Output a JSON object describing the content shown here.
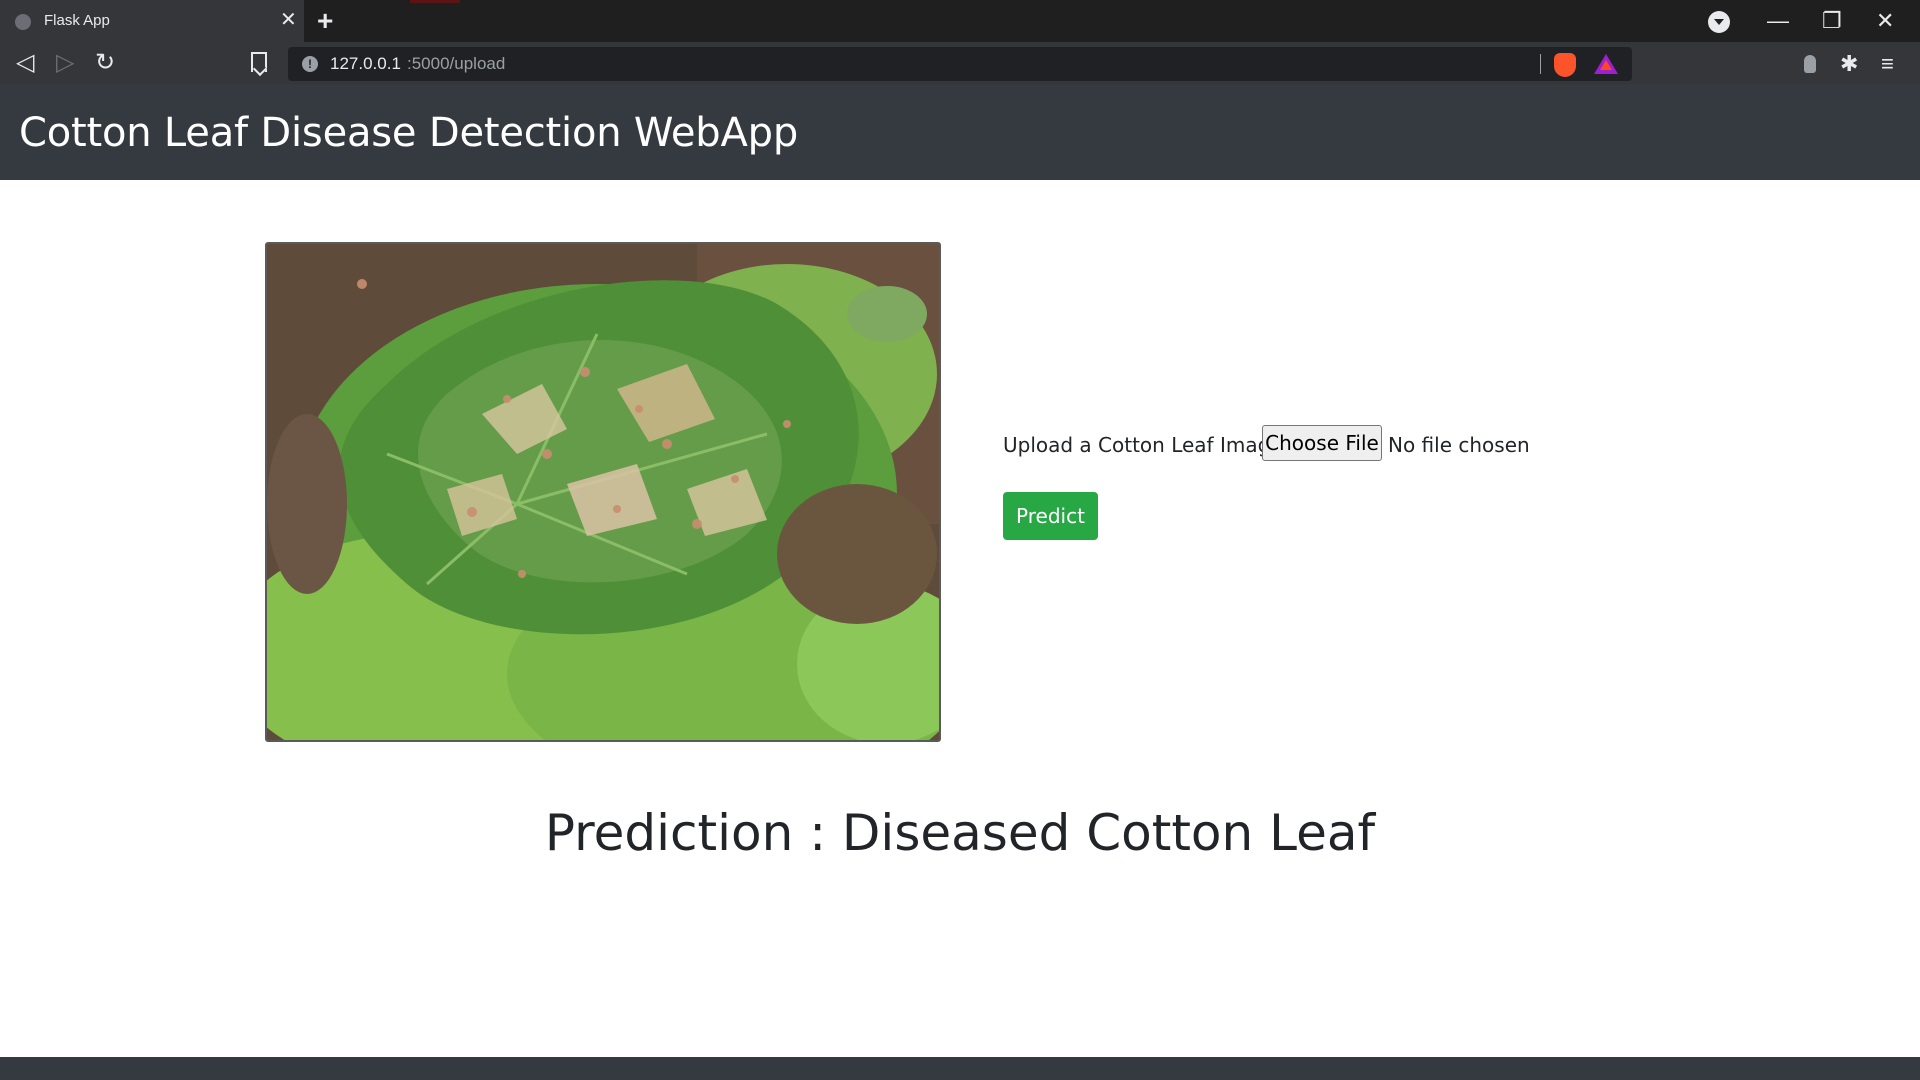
{
  "browser": {
    "tab_title": "Flask App",
    "tab_close": "✕",
    "new_tab": "+",
    "url_host": "127.0.0.1",
    "url_path": ":5000/upload",
    "info_icon": "!",
    "icons": [
      "globe-icon",
      "close-icon",
      "plus-icon",
      "tab-search-icon",
      "minimize-icon",
      "maximize-icon",
      "window-close-icon",
      "back-icon",
      "forward-icon",
      "reload-icon",
      "bookmark-icon",
      "info-icon",
      "brave-shield-icon",
      "brave-rewards-icon",
      "profile-icon",
      "extensions-icon",
      "menu-icon"
    ]
  },
  "window_controls": {
    "minimize": "—",
    "maximize": "❐",
    "close": "✕"
  },
  "nav": {
    "back": "◁",
    "forward": "▷",
    "reload": "↻",
    "puzzle": "✱",
    "menu": "≡"
  },
  "page": {
    "brand": "Cotton Leaf Disease Detection WebApp",
    "upload_label": "Upload a Cotton Leaf Image:",
    "file_button": "Choose File",
    "file_status": "No file chosen",
    "predict_button": "Predict",
    "prediction_text": "Prediction : Diseased Cotton Leaf"
  },
  "colors": {
    "navbar": "#343a40",
    "predict": "#28a745",
    "browser_chrome": "#35363a"
  }
}
